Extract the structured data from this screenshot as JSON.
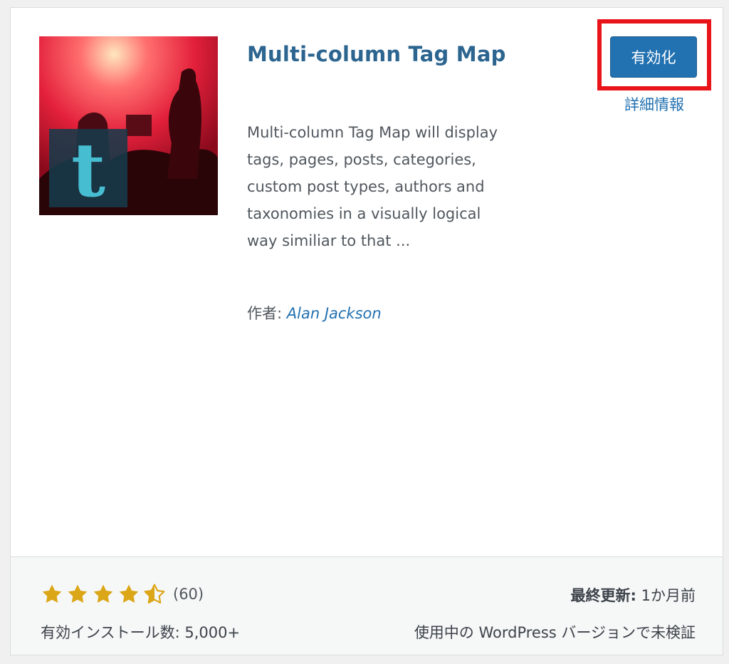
{
  "plugin": {
    "title": "Multi-column Tag Map",
    "description": "Multi-column Tag Map will display tags, pages, posts, categories, custom post types, authors and taxonomies in a visually logical way similiar to that ...",
    "author_label": "作者:",
    "author_name": "Alan Jackson",
    "thumbnail_letter": "t"
  },
  "actions": {
    "activate_label": "有効化",
    "details_label": "詳細情報"
  },
  "footer": {
    "rating": 4.5,
    "rating_count": "(60)",
    "installs": "有効インストール数: 5,000+",
    "last_updated_label": "最終更新:",
    "last_updated_value": "1か月前",
    "compatibility": "使用中の WordPress バージョンで未検証"
  },
  "colors": {
    "accent": "#2271b1",
    "title": "#2c6590",
    "highlight": "#e8141a",
    "star": "#dba617"
  },
  "icons": [
    "star-filled-icon",
    "star-half-icon"
  ]
}
